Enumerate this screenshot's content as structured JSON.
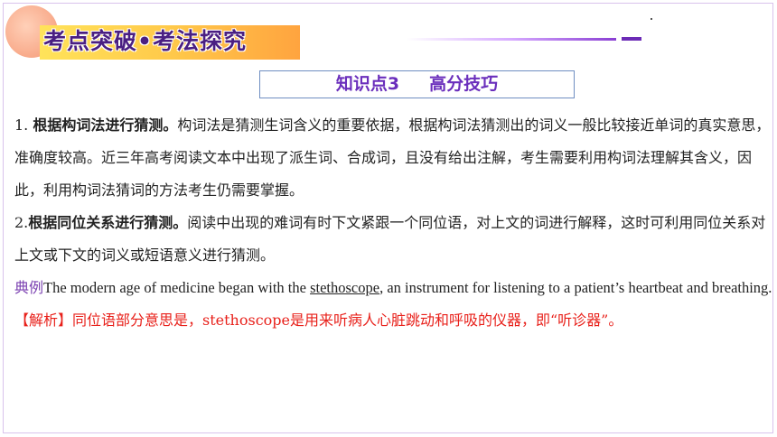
{
  "header": {
    "title": "考点突破•考法探究"
  },
  "knowledge_point": {
    "label": "知识点3",
    "topic": "高分技巧"
  },
  "para1": {
    "number": "1. ",
    "heading": "根据构词法进行猜测。",
    "body": "构词法是猜测生词含义的重要依据，根据构词法猜测出的词义一般比较接近单词的真实意思，准确度较高。近三年高考阅读文本中出现了派生词、合成词，且没有给出注解，考生需要利用构词法理解其含义，因此，利用构词法猜词的方法考生仍需要掌握。"
  },
  "para2": {
    "number": "2.",
    "heading": "根据同位关系进行猜测。",
    "body": "阅读中出现的难词有时下文紧跟一个同位语，对上文的词进行解释，这时可利用同位关系对上文或下文的词义或短语意义进行猜测。"
  },
  "example": {
    "label": "典例",
    "text_before": "The modern age of medicine began with the ",
    "keyword": "stethoscope",
    "text_after": ", an instrument for listening to a patient’s heartbeat and breathing."
  },
  "analysis": {
    "text": "【解析】同位语部分意思是，stethoscope是用来听病人心脏跳动和呼吸的仪器，即“听诊器”。"
  },
  "colors": {
    "title": "#4a1f82",
    "banner_start": "#ffe35a",
    "banner_end": "#ffa43f",
    "accent_purple": "#7a3fb0",
    "analysis_red": "#e8201a"
  }
}
